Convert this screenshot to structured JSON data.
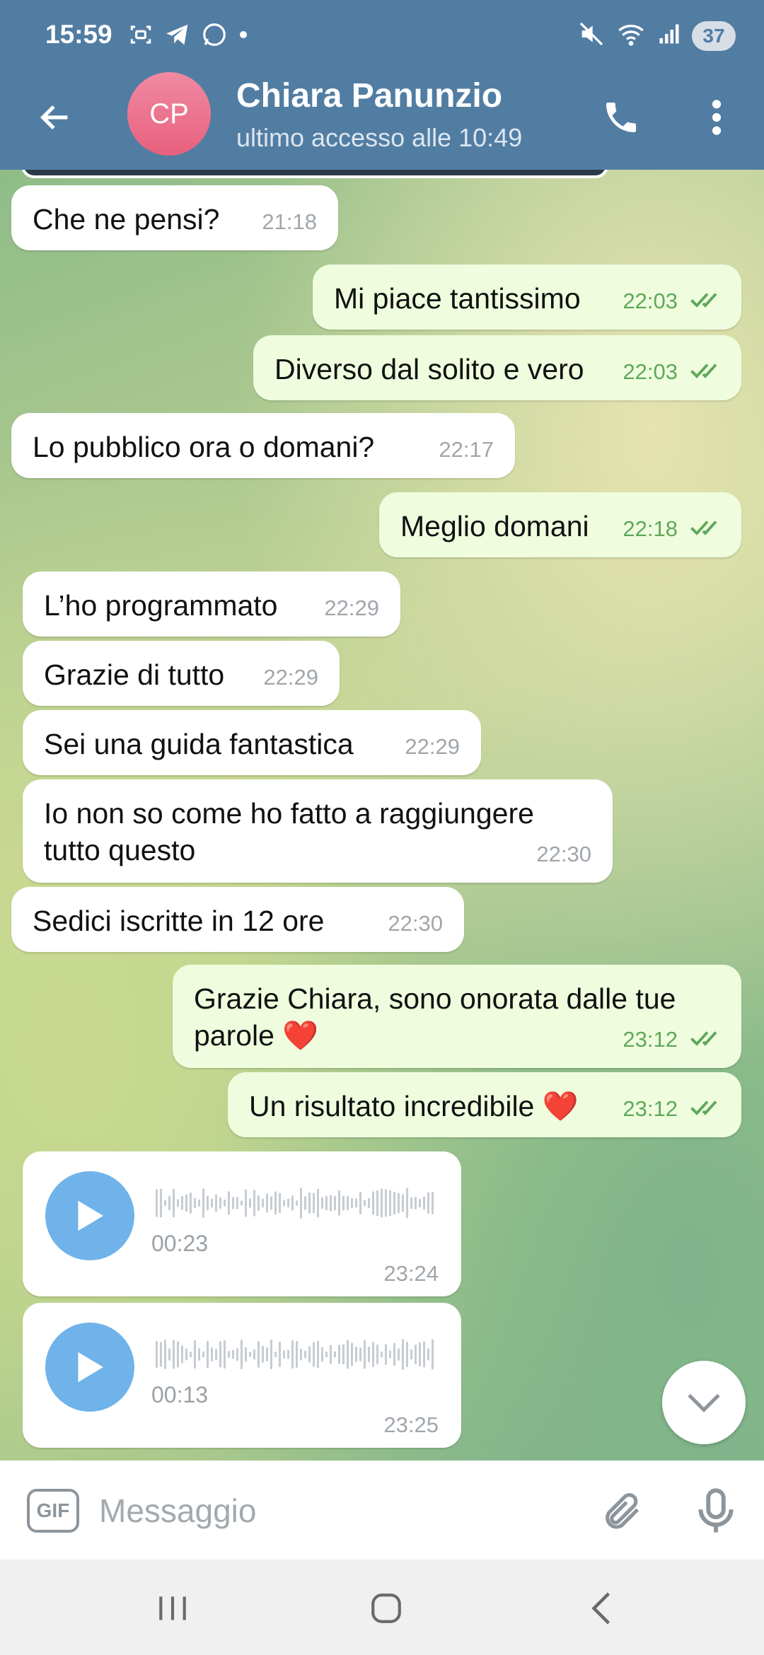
{
  "status_bar": {
    "time": "15:59",
    "battery": "37"
  },
  "header": {
    "avatar_initials": "CP",
    "contact_name": "Chiara Panunzio",
    "contact_status": "ultimo accesso alle 10:49"
  },
  "messages": [
    {
      "dir": "in",
      "text": "Che ne pensi?",
      "time": "21:18"
    },
    {
      "dir": "out",
      "text": "Mi piace tantissimo",
      "time": "22:03"
    },
    {
      "dir": "out",
      "text": "Diverso dal solito e vero",
      "time": "22:03"
    },
    {
      "dir": "in",
      "text": "Lo pubblico ora o domani?",
      "time": "22:17"
    },
    {
      "dir": "out",
      "text": "Meglio domani",
      "time": "22:18"
    },
    {
      "dir": "in",
      "text": "L’ho programmato",
      "time": "22:29"
    },
    {
      "dir": "in",
      "text": "Grazie di tutto",
      "time": "22:29"
    },
    {
      "dir": "in",
      "text": "Sei una guida fantastica",
      "time": "22:29"
    },
    {
      "dir": "in",
      "text": "Io non so come ho fatto a raggiungere\ntutto questo",
      "time": "22:30"
    },
    {
      "dir": "in",
      "text": "Sedici iscritte in 12 ore",
      "time": "22:30"
    },
    {
      "dir": "out",
      "text": "Grazie Chiara, sono onorata dalle tue\nparole ❤️",
      "time": "23:12"
    },
    {
      "dir": "out",
      "text": "Un risultato incredibile ❤️",
      "time": "23:12"
    }
  ],
  "voice_messages": [
    {
      "duration": "00:23",
      "time": "23:24"
    },
    {
      "duration": "00:13",
      "time": "23:25"
    }
  ],
  "input": {
    "gif_label": "GIF",
    "placeholder": "Messaggio"
  },
  "colors": {
    "header": "#527da3",
    "outgoing_bubble": "#effdde",
    "incoming_bubble": "#ffffff",
    "accent_play": "#6fb3ea",
    "check_green": "#5ea85a"
  }
}
